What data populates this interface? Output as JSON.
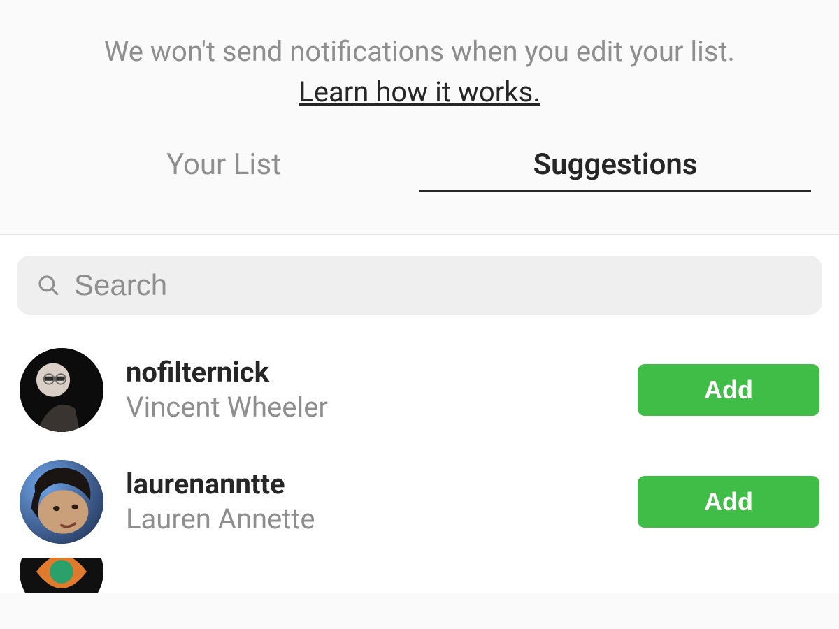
{
  "header": {
    "info": "We won't send notifications when you edit your list.",
    "learn_link": "Learn how it works."
  },
  "tabs": {
    "your_list": "Your List",
    "suggestions": "Suggestions",
    "active": "suggestions"
  },
  "search": {
    "placeholder": "Search",
    "value": ""
  },
  "add_label": "Add",
  "suggestions": [
    {
      "username": "nofilternick",
      "display_name": "Vincent Wheeler"
    },
    {
      "username": "laurenanntte",
      "display_name": "Lauren Annette"
    }
  ],
  "colors": {
    "add_button": "#3fbd46",
    "muted_text": "#8e8e8e",
    "search_bg": "#efefef"
  }
}
